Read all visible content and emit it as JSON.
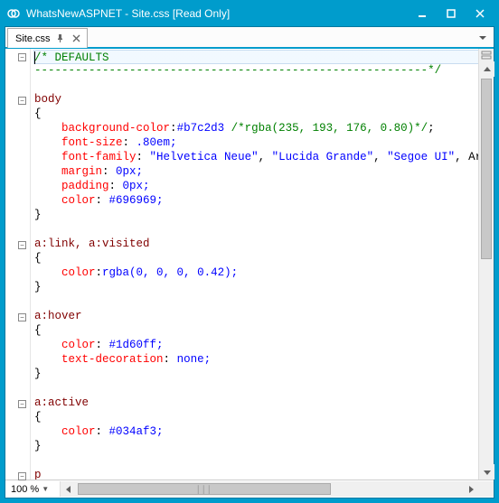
{
  "titlebar": {
    "title": "WhatsNewASPNET - Site.css [Read Only]"
  },
  "tab": {
    "label": "Site.css"
  },
  "zoom": {
    "value": "100 %"
  },
  "code": {
    "lines": [
      {
        "t": "comment-start",
        "cursor": true,
        "text": "/* DEFAULTS"
      },
      {
        "t": "comment-line",
        "text": "----------------------------------------------------------*/"
      },
      {
        "t": "blank"
      },
      {
        "t": "selector",
        "text": "body"
      },
      {
        "t": "brace-open"
      },
      {
        "t": "decl",
        "prop": "background-color",
        "val": "#b7c2d3 ",
        "post_comment": "/*rgba(235, 193, 176, 0.80)*/",
        "tail": ";"
      },
      {
        "t": "decl",
        "prop": "font-size",
        "val": " .80em;"
      },
      {
        "t": "decl-str",
        "prop": "font-family",
        "strs": [
          "\"Helvetica Neue\"",
          "\"Lucida Grande\"",
          "\"Segoe UI\""
        ],
        "tail_plain": ", Aria"
      },
      {
        "t": "decl",
        "prop": "margin",
        "val": " 0px;"
      },
      {
        "t": "decl",
        "prop": "padding",
        "val": " 0px;"
      },
      {
        "t": "decl",
        "prop": "color",
        "val": " #696969;"
      },
      {
        "t": "brace-close"
      },
      {
        "t": "blank"
      },
      {
        "t": "selector",
        "text": "a:link, a:visited"
      },
      {
        "t": "brace-open"
      },
      {
        "t": "decl",
        "prop": "color",
        "val": "rgba(0, 0, 0, 0.42);"
      },
      {
        "t": "brace-close"
      },
      {
        "t": "blank"
      },
      {
        "t": "selector",
        "text": "a:hover"
      },
      {
        "t": "brace-open"
      },
      {
        "t": "decl",
        "prop": "color",
        "val": " #1d60ff;"
      },
      {
        "t": "decl",
        "prop": "text-decoration",
        "val": " none;"
      },
      {
        "t": "brace-close"
      },
      {
        "t": "blank"
      },
      {
        "t": "selector",
        "text": "a:active"
      },
      {
        "t": "brace-open"
      },
      {
        "t": "decl",
        "prop": "color",
        "val": " #034af3;"
      },
      {
        "t": "brace-close"
      },
      {
        "t": "blank"
      },
      {
        "t": "selector",
        "text": "p"
      }
    ]
  },
  "outline_markers": [
    0,
    3,
    13,
    18,
    24,
    29
  ]
}
